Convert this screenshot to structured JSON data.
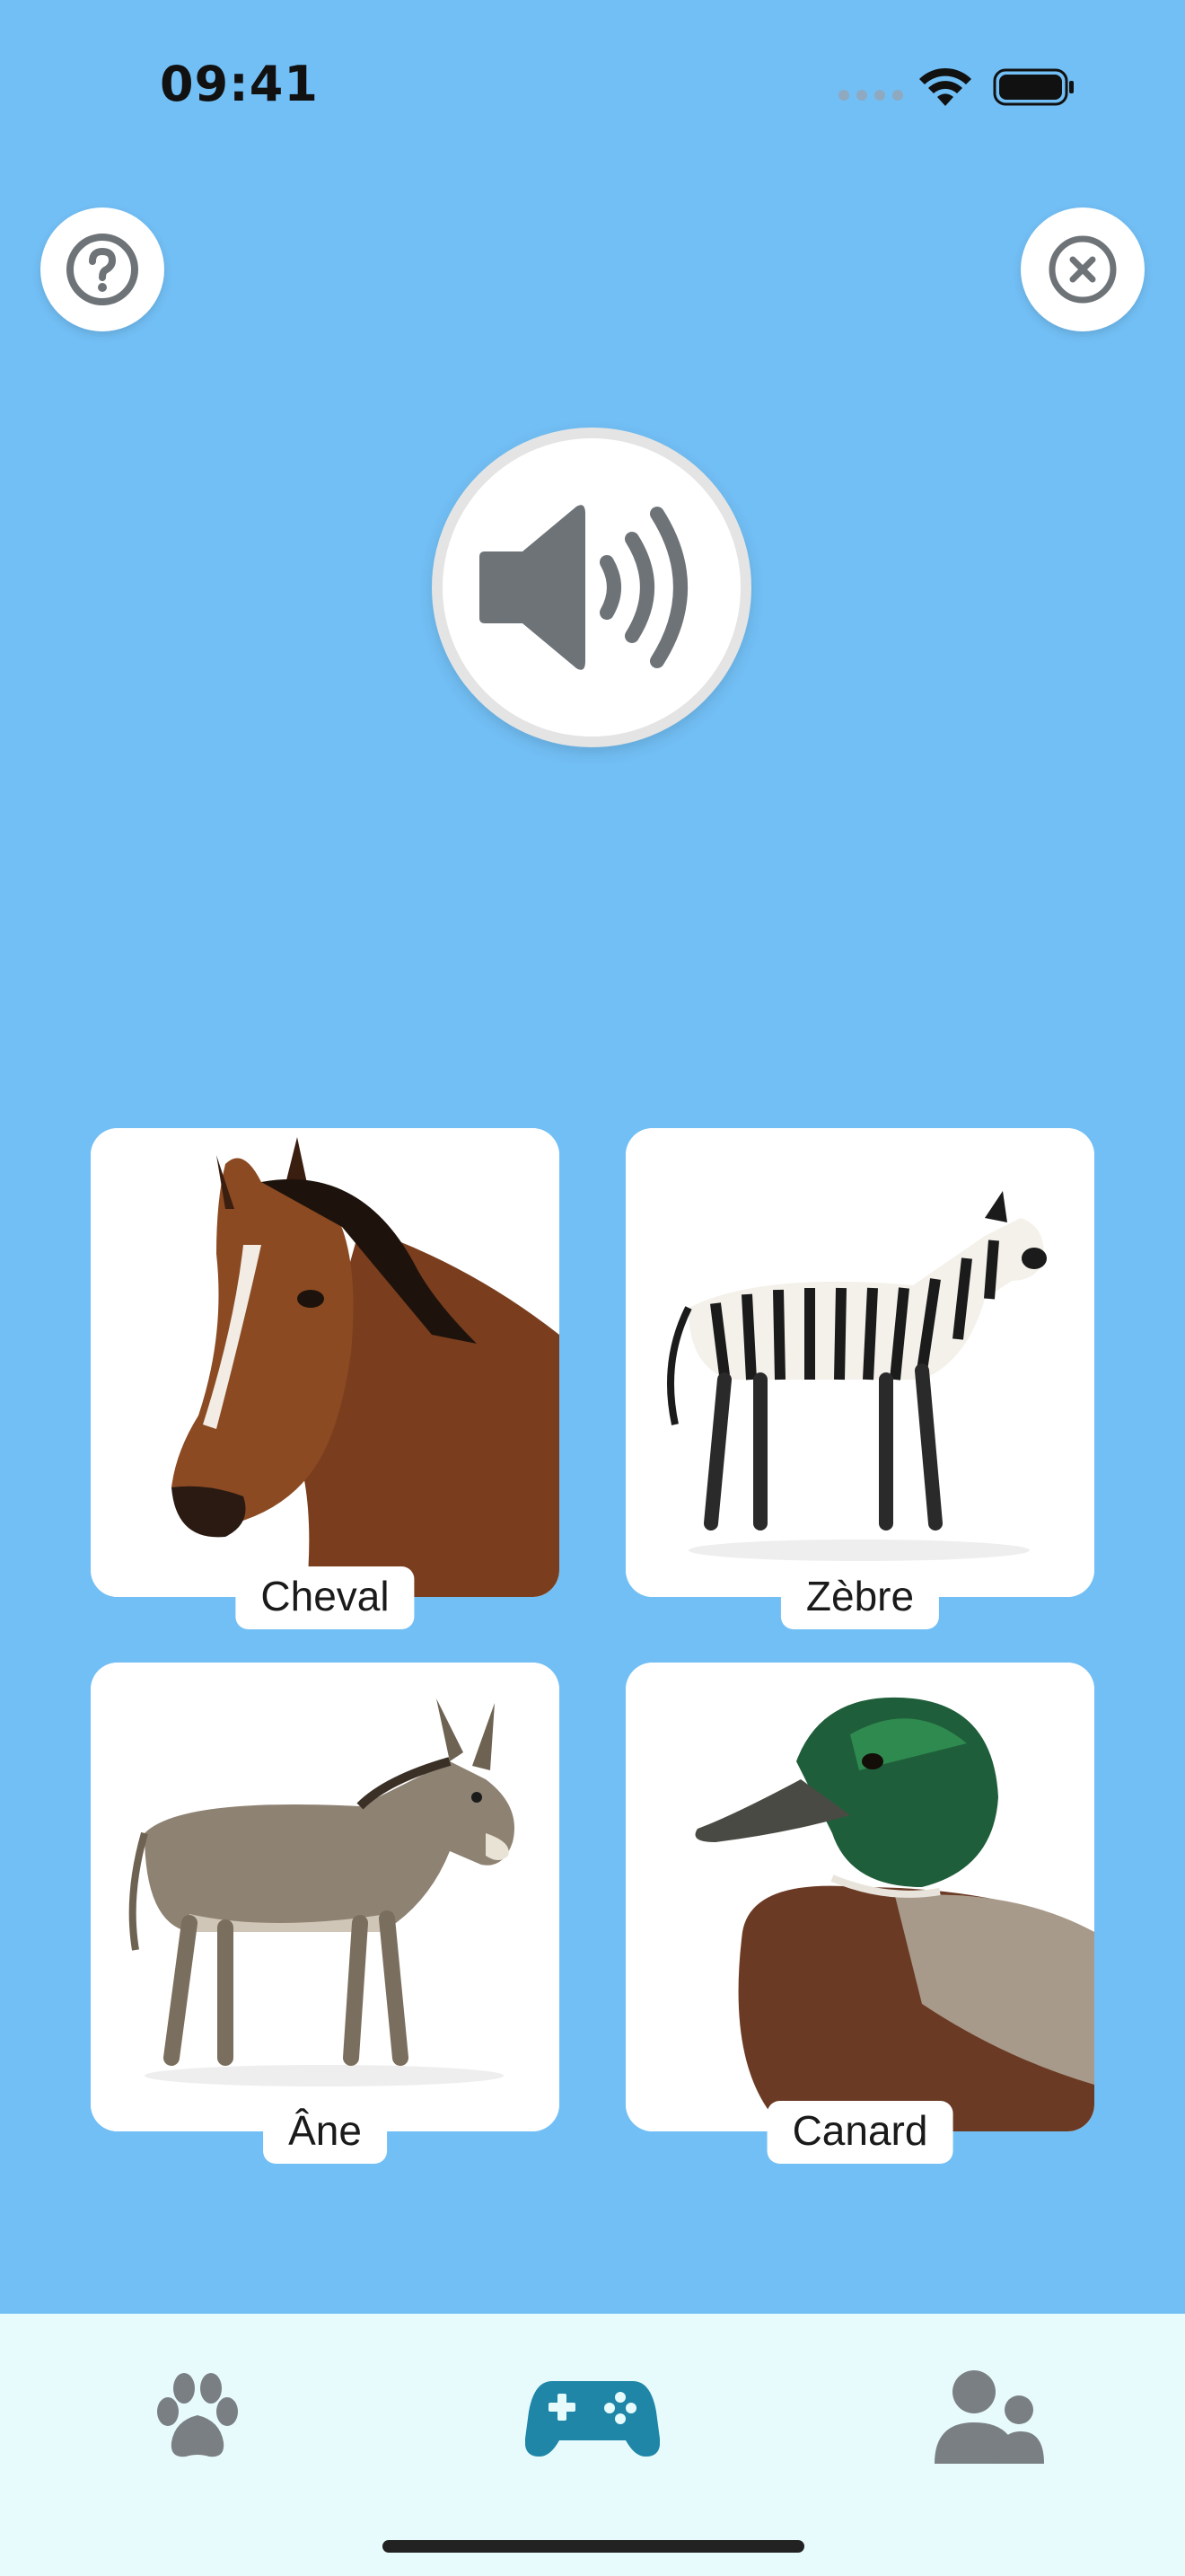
{
  "status_bar": {
    "time": "09:41"
  },
  "top_buttons": {
    "help_icon": "question-circle-icon",
    "close_icon": "close-circle-icon"
  },
  "speaker": {
    "icon": "speaker-volume-icon"
  },
  "cards": [
    {
      "label": "Cheval",
      "image": "horse-image"
    },
    {
      "label": "Zèbre",
      "image": "zebra-image"
    },
    {
      "label": "Âne",
      "image": "donkey-image"
    },
    {
      "label": "Canard",
      "image": "duck-image"
    }
  ],
  "tab_bar": {
    "tabs": [
      {
        "icon": "paw-icon",
        "active": false
      },
      {
        "icon": "gamepad-icon",
        "active": true
      },
      {
        "icon": "users-icon",
        "active": false
      }
    ]
  },
  "colors": {
    "background": "#72bff5",
    "tab_bar": "#e7fbfc",
    "active_tab": "#1f86a8",
    "inactive_tab": "#7a7f84",
    "icon_gray": "#6e7378"
  }
}
